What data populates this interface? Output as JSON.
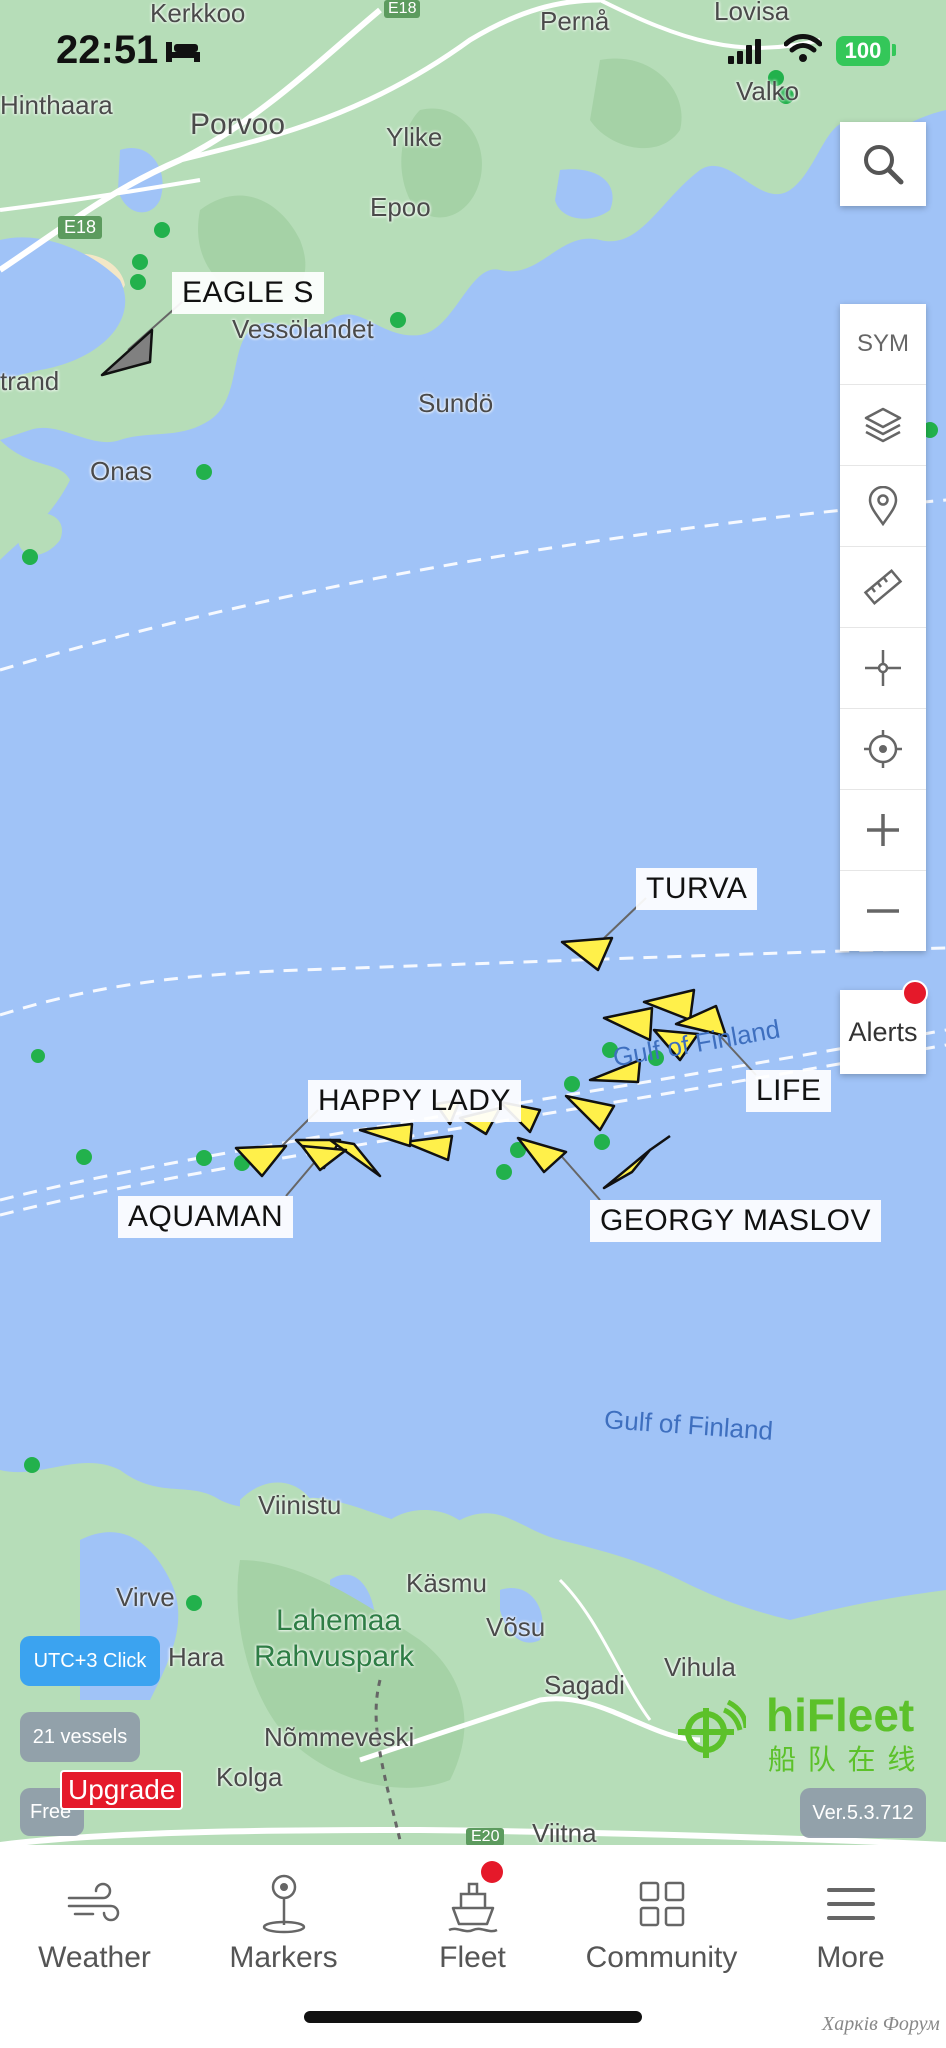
{
  "status_bar": {
    "time": "22:51",
    "battery": "100",
    "icons": [
      "bed-icon",
      "signal-icon",
      "wifi-icon",
      "battery-icon"
    ]
  },
  "map": {
    "places": {
      "kerkkoo": "Kerkkoo",
      "perna": "Pernå",
      "lovisa": "Lovisa",
      "e18_top": "E18",
      "hinthaara": "Hinthaara",
      "porvoo": "Porvoo",
      "ylike": "Ylike",
      "valko": "Valko",
      "epoo": "Epoo",
      "e18": "E18",
      "vessolandet": "Vessölandet",
      "trand": "trand",
      "sundo": "Sundö",
      "onas": "Onas",
      "gulf_finland_1": "Gulf of Finland",
      "gulf_finland_2": "Gulf of Finland",
      "viinistu": "Viinistu",
      "kasmu": "Käsmu",
      "virve": "Virve",
      "lahemaa": "Lahemaa",
      "rahvuspark": "Rahvuspark",
      "vosu": "Võsu",
      "hara": "Hara",
      "sagadi": "Sagadi",
      "vihula": "Vihula",
      "nommeveski": "Nõmmeveski",
      "kolga": "Kolga",
      "viitna": "Viitna",
      "e20": "E20"
    },
    "vessel_labels": {
      "eagle": "EAGLE S",
      "turva": "TURVA",
      "life": "LIFE",
      "happy_lady": "HAPPY LADY",
      "aquaman": "AQUAMAN",
      "georgy": "GEORGY MASLOV"
    },
    "colors": {
      "water": "#a0c3f7",
      "land": "#b6ddb8",
      "vessel": "#fff04a",
      "vessel_selected": "#808080",
      "station": "#22b14c"
    }
  },
  "controls": {
    "search_icon": "search-icon",
    "buttons": [
      {
        "name": "sym-button",
        "label": "SYM"
      },
      {
        "name": "layers-button",
        "icon": "layers-icon"
      },
      {
        "name": "marker-button",
        "icon": "location-pin-icon"
      },
      {
        "name": "ruler-button",
        "icon": "ruler-icon"
      },
      {
        "name": "center-button",
        "icon": "crosshair-icon"
      },
      {
        "name": "locate-button",
        "icon": "target-icon"
      },
      {
        "name": "zoom-in-button",
        "icon": "plus-icon"
      },
      {
        "name": "zoom-out-button",
        "icon": "minus-icon"
      }
    ],
    "sym_label": "SYM",
    "alerts_label": "Alerts"
  },
  "overlay": {
    "utc_button": "UTC+3 Click",
    "vessel_count": "21 vessels",
    "plan": "Free",
    "upgrade": "Upgrade",
    "brand": "hiFleet",
    "brand_cn": "船 队 在 线",
    "version": "Ver.5.3.712",
    "colors": {
      "utc": "#3ba3f0",
      "badge": "#8e9aa8",
      "upgrade": "#e5192a",
      "brand": "#5cc12a"
    }
  },
  "tabs": [
    {
      "name": "tab-weather",
      "label": "Weather",
      "icon": "wind-icon"
    },
    {
      "name": "tab-markers",
      "label": "Markers",
      "icon": "map-pin-icon"
    },
    {
      "name": "tab-fleet",
      "label": "Fleet",
      "icon": "ship-icon",
      "badge": true
    },
    {
      "name": "tab-community",
      "label": "Community",
      "icon": "grid-icon"
    },
    {
      "name": "tab-more",
      "label": "More",
      "icon": "menu-icon"
    }
  ],
  "watermark": "Харків Форум"
}
